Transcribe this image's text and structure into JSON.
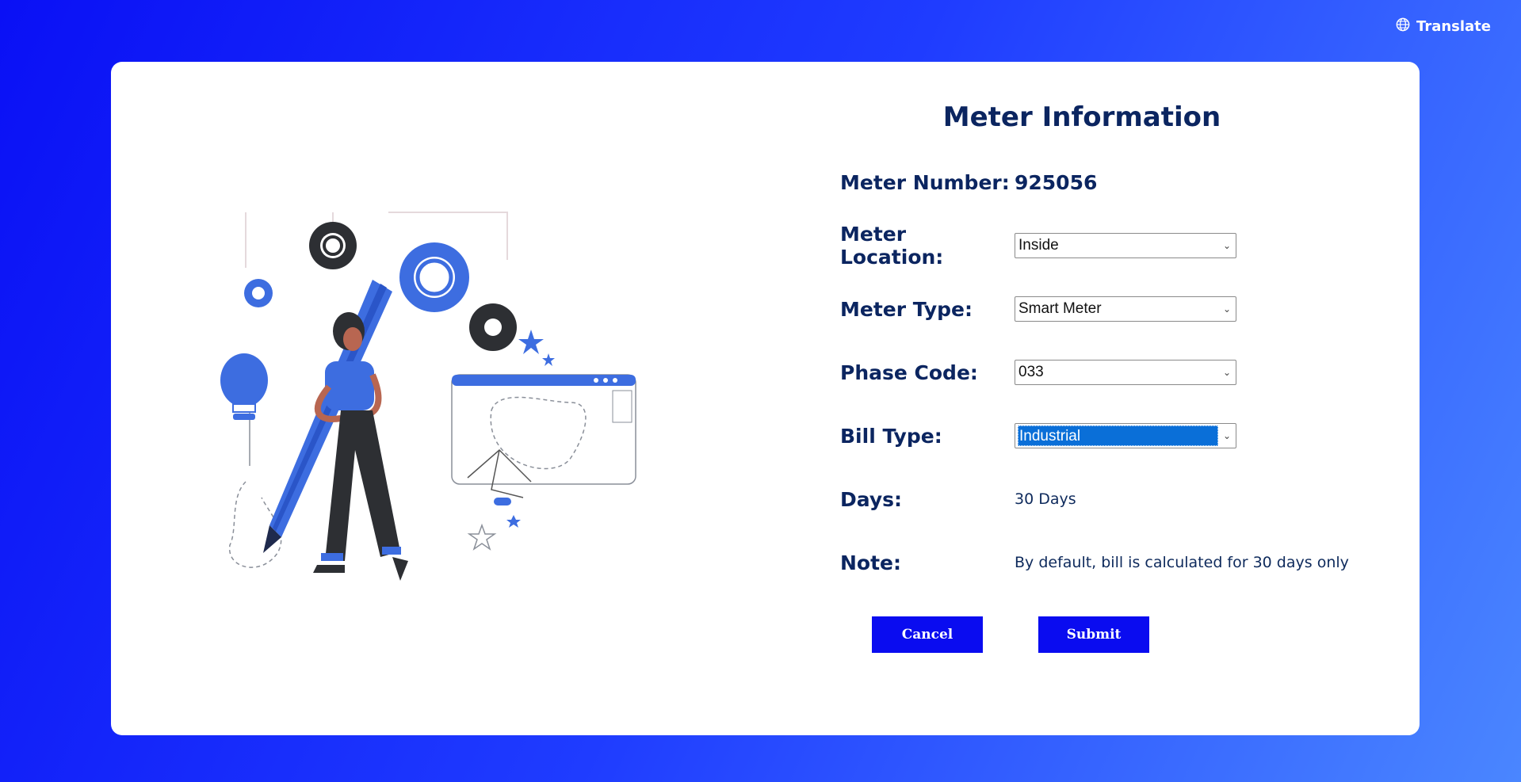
{
  "header": {
    "translate_label": "Translate"
  },
  "form": {
    "title": "Meter Information",
    "meter_number": {
      "label": "Meter Number:",
      "value": "925056"
    },
    "meter_location": {
      "label": "Meter Location:",
      "selected": "Inside"
    },
    "meter_type": {
      "label": "Meter Type:",
      "selected": "Smart Meter"
    },
    "phase_code": {
      "label": "Phase Code:",
      "selected": "033"
    },
    "bill_type": {
      "label": "Bill Type:",
      "selected": "Industrial"
    },
    "days": {
      "label": "Days:",
      "value": "30 Days"
    },
    "note": {
      "label": "Note:",
      "value": "By default, bill is calculated for 30 days only"
    },
    "cancel_label": "Cancel",
    "submit_label": "Submit"
  },
  "colors": {
    "accent": "#0a0cf0",
    "heading": "#0b2560",
    "selection": "#0a6fd8"
  }
}
